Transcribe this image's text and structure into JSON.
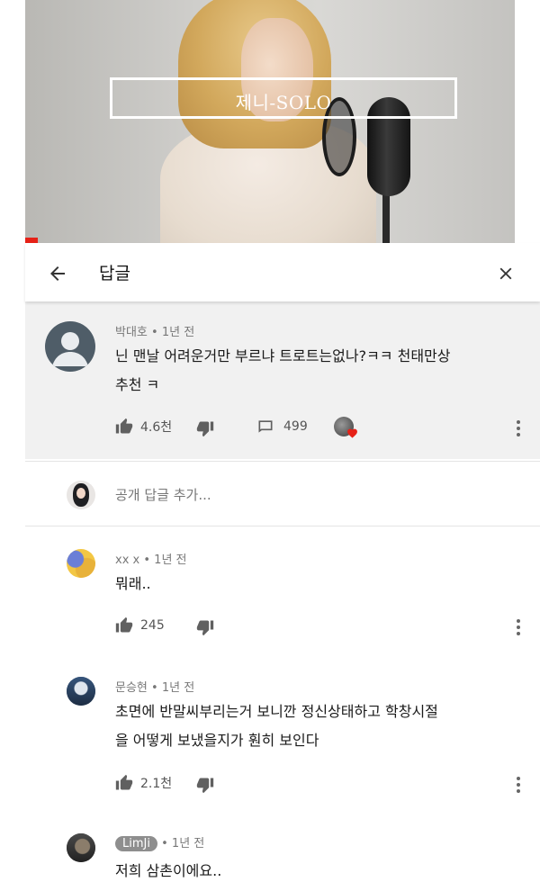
{
  "video": {
    "title_overlay": "제니-SOLO"
  },
  "header": {
    "title": "답글"
  },
  "main_comment": {
    "author": "박대호",
    "time": "1년 전",
    "text_line1": "닌 맨날 어려운거만 부르냐 트로트는없나?ㅋㅋ 천태만상",
    "text_line2": "추천 ㅋ",
    "likes": "4.6천",
    "replies": "499"
  },
  "add_reply": {
    "placeholder": "공개 답글 추가..."
  },
  "replies": [
    {
      "author": "xx x",
      "time": "1년 전",
      "text_line1": "뭐래..",
      "text_line2": "",
      "likes": "245"
    },
    {
      "author": "문승현",
      "time": "1년 전",
      "text_line1": "초면에 반말씨부리는거 보니깐 정신상태하고 학창시절",
      "text_line2": "을 어떻게 보냈을지가 훤히 보인다",
      "likes": "2.1천"
    },
    {
      "author": "LimJi",
      "time": "1년 전",
      "text_line1": "저희 삼촌이에요..",
      "text_line2": "",
      "likes": ""
    }
  ],
  "separator": "•",
  "colors": {
    "progress_red": "#e62117",
    "heart_red": "#e62117",
    "selected_comment_bg": "#f1f1f1"
  }
}
